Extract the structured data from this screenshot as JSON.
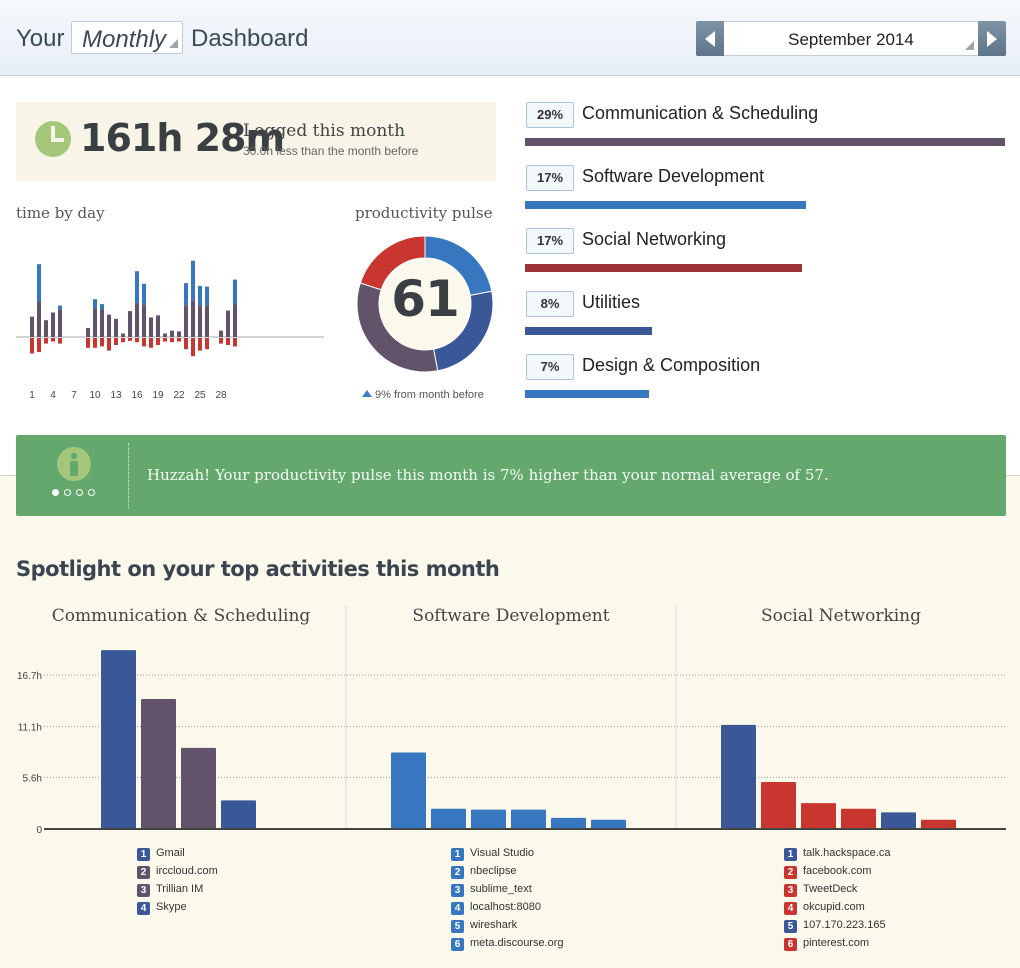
{
  "header": {
    "prefix": "Your",
    "period": "Monthly",
    "suffix": "Dashboard",
    "month": "September 2014"
  },
  "summary": {
    "total": "161h 28m",
    "label": "Logged this month",
    "sub": "30.0h less than the month before"
  },
  "time_by_day": {
    "title": "time by day",
    "ticks": [
      "1",
      "4",
      "7",
      "10",
      "13",
      "16",
      "19",
      "22",
      "25",
      "28"
    ]
  },
  "pulse": {
    "title": "productivity pulse",
    "value": "61",
    "change": "9% from month before",
    "segments": [
      {
        "color": "#3677bf",
        "fraction": 0.22
      },
      {
        "color": "#3a5898",
        "fraction": 0.25
      },
      {
        "color": "#62536b",
        "fraction": 0.33
      },
      {
        "color": "#c9352f",
        "fraction": 0.2
      }
    ]
  },
  "categories": [
    {
      "pct": "29%",
      "label": "Communication & Scheduling",
      "fraction": 1.0,
      "color": "#62536b"
    },
    {
      "pct": "17%",
      "label": "Software Development",
      "fraction": 0.585,
      "color": "#3677bf"
    },
    {
      "pct": "17%",
      "label": "Social Networking",
      "fraction": 0.577,
      "color": "#9c3438"
    },
    {
      "pct": "8%",
      "label": "Utilities",
      "fraction": 0.264,
      "color": "#3a5898"
    },
    {
      "pct": "7%",
      "label": "Design & Composition",
      "fraction": 0.258,
      "color": "#3677bf"
    }
  ],
  "info": {
    "text": "Huzzah! Your productivity pulse this month is 7% higher than your normal average of 57."
  },
  "spotlight": {
    "title": "Spotlight on your top activities this month",
    "columns": [
      {
        "title": "Communication & Scheduling",
        "items": [
          {
            "n": "1",
            "label": "Gmail",
            "color": "#3a5898"
          },
          {
            "n": "2",
            "label": "irccloud.com",
            "color": "#62536b"
          },
          {
            "n": "3",
            "label": "Trillian IM",
            "color": "#62536b"
          },
          {
            "n": "4",
            "label": "Skype",
            "color": "#3a5898"
          }
        ]
      },
      {
        "title": "Software Development",
        "items": [
          {
            "n": "1",
            "label": "Visual Studio",
            "color": "#3677bf"
          },
          {
            "n": "2",
            "label": "nbeclipse",
            "color": "#3677bf"
          },
          {
            "n": "3",
            "label": "sublime_text",
            "color": "#3677bf"
          },
          {
            "n": "4",
            "label": "localhost:8080",
            "color": "#3677bf"
          },
          {
            "n": "5",
            "label": "wireshark",
            "color": "#3677bf"
          },
          {
            "n": "6",
            "label": "meta.discourse.org",
            "color": "#3677bf"
          }
        ]
      },
      {
        "title": "Social Networking",
        "items": [
          {
            "n": "1",
            "label": "talk.hackspace.ca",
            "color": "#3a5898"
          },
          {
            "n": "2",
            "label": "facebook.com",
            "color": "#c9352f"
          },
          {
            "n": "3",
            "label": "TweetDeck",
            "color": "#c9352f"
          },
          {
            "n": "4",
            "label": "okcupid.com",
            "color": "#c9352f"
          },
          {
            "n": "5",
            "label": "107.170.223.165",
            "color": "#3a5898"
          },
          {
            "n": "6",
            "label": "pinterest.com",
            "color": "#c9352f"
          }
        ]
      }
    ]
  },
  "chart_data": [
    {
      "type": "bar",
      "title": "time by day",
      "categories": [
        "1",
        "2",
        "3",
        "4",
        "5",
        "6",
        "7",
        "8",
        "9",
        "10",
        "11",
        "12",
        "13",
        "14",
        "15",
        "16",
        "17",
        "18",
        "19",
        "20",
        "21",
        "22",
        "23",
        "24",
        "25",
        "26",
        "27",
        "28",
        "29",
        "30"
      ],
      "ticks": [
        "1",
        "4",
        "7",
        "10",
        "13",
        "16",
        "19",
        "22",
        "25",
        "28"
      ],
      "series": [
        {
          "colors": [
            "#3677bf",
            "#62536b"
          ],
          "values": [
            2.9,
            10.4,
            2.4,
            3.5,
            4.5,
            0,
            0,
            0,
            1.3,
            5.4,
            4.7,
            3.2,
            2.6,
            0.5,
            3.7,
            9.4,
            7.6,
            2.8,
            3.1,
            0.5,
            0.9,
            0.8,
            7.7,
            10.9,
            7.3,
            7.2,
            0,
            0.9,
            3.8,
            8.2
          ]
        },
        {
          "colors": [
            "#c9352f"
          ],
          "values": [
            -2.2,
            -2.0,
            -0.8,
            -0.5,
            -0.8,
            0,
            0,
            0,
            -1.4,
            -1.4,
            -1.2,
            -1.8,
            -1.0,
            -0.6,
            -0.4,
            -0.6,
            -1.2,
            -1.4,
            -1.0,
            -0.5,
            -0.6,
            -0.5,
            -1.6,
            -2.6,
            -1.8,
            -1.6,
            0,
            -0.8,
            -1.0,
            -1.2
          ]
        }
      ]
    },
    {
      "type": "pie",
      "title": "productivity pulse",
      "values": [
        22,
        25,
        33,
        20
      ]
    },
    {
      "type": "bar",
      "title": "Spotlight on your top activities this month",
      "ylim": [
        0,
        20.5
      ],
      "yticks": [
        "0",
        "5.6h",
        "11.1h",
        "16.7h"
      ],
      "yticks_values": [
        0,
        5.6,
        11.1,
        16.7
      ],
      "groups": [
        {
          "name": "Communication & Scheduling",
          "values": [
            19.4,
            14.1,
            8.8,
            3.1
          ],
          "colors": [
            "#3a5898",
            "#62536b",
            "#62536b",
            "#3a5898"
          ]
        },
        {
          "name": "Software Development",
          "values": [
            8.3,
            2.2,
            2.1,
            2.1,
            1.2,
            1.0
          ],
          "colors": [
            "#3677bf",
            "#3677bf",
            "#3677bf",
            "#3677bf",
            "#3677bf",
            "#3677bf"
          ]
        },
        {
          "name": "Social Networking",
          "values": [
            11.3,
            5.1,
            2.8,
            2.2,
            1.8,
            1.0
          ],
          "colors": [
            "#3a5898",
            "#c9352f",
            "#c9352f",
            "#c9352f",
            "#3a5898",
            "#c9352f"
          ]
        }
      ]
    }
  ]
}
